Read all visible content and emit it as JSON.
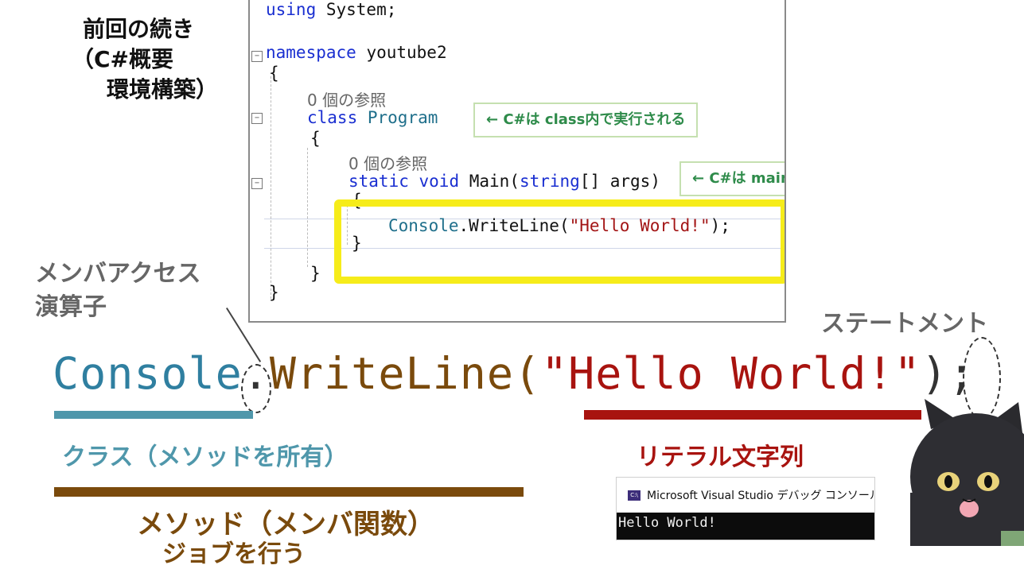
{
  "caption": {
    "line1": "前回の続き",
    "line2": "（C#概要",
    "line3": "環境構築）"
  },
  "editor": {
    "using_kw": "using",
    "using_rest": " System;",
    "namespace_kw": "namespace",
    "namespace_name": " youtube2",
    "brace_open": "{",
    "brace_close": "}",
    "ref_class": "0 個の参照",
    "class_kw": "class",
    "class_name": "Program",
    "ref_main": "0 個の参照",
    "static_kw": "static",
    "void_kw": "void",
    "main_sig_mid": "Main(",
    "string_kw": "string",
    "main_sig_end": "[] args)",
    "console_cls": "Console",
    "writeline_call": ".WriteLine(",
    "hello_str": "\"Hello World!\"",
    "call_end": ");"
  },
  "annotations": {
    "class_note": "← C#は class内で実行される",
    "main_note": "← C#は main関数で開始・終了"
  },
  "labels": {
    "member_access_1": "メンバアクセス",
    "member_access_2": "演算子",
    "statement": "ステートメント",
    "class_label": "クラス（メソッドを所有）",
    "literal_label": "リテラル文字列",
    "method_label": "メソッド（メンバ関数）",
    "method_label_2": "ジョブを行う"
  },
  "big_line": {
    "class_part": "Console",
    "dot": ".",
    "method_part": "WriteLine(",
    "string_part": "\"Hello World!\"",
    "close_part": ")",
    "semicolon": ";"
  },
  "console_window": {
    "title": "Microsoft Visual Studio デバッグ コンソール",
    "icon_text": "C:\\",
    "output": "Hello World!"
  },
  "colors": {
    "keyword": "#1a2fd1",
    "class": "#1f6f8b",
    "string": "#a31515",
    "highlight": "#f6ec1a",
    "note_green": "#2e8b4a",
    "method_brown": "#7a4a0c"
  }
}
